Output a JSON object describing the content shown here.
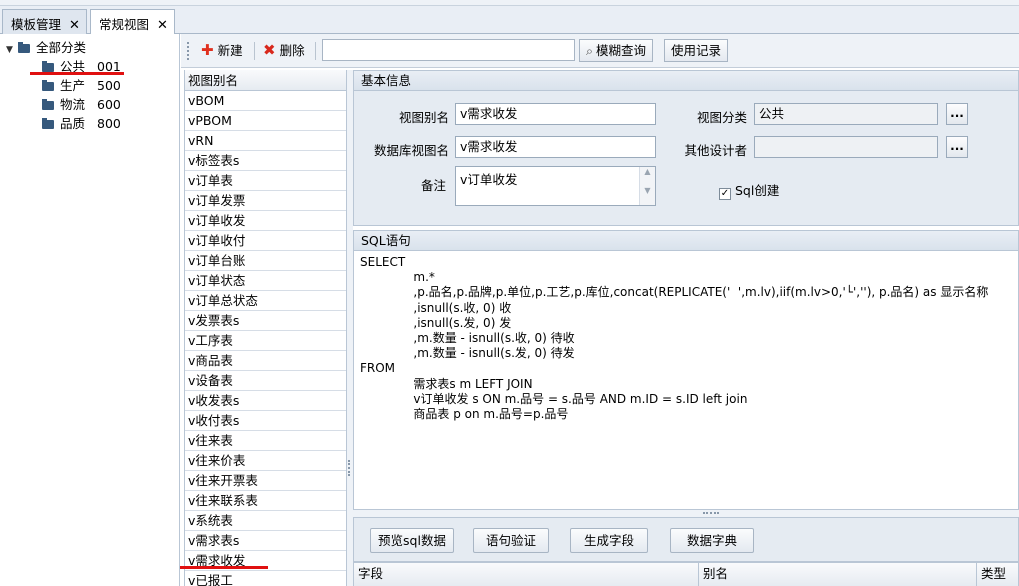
{
  "tabs": [
    {
      "label": "模板管理",
      "active": false
    },
    {
      "label": "常规视图",
      "active": true
    }
  ],
  "tab_close_glyph": "✕",
  "tree": {
    "root_label": "全部分类",
    "items": [
      {
        "name": "公共",
        "code": "001"
      },
      {
        "name": "生产",
        "code": "500"
      },
      {
        "name": "物流",
        "code": "600"
      },
      {
        "name": "品质",
        "code": "800"
      }
    ]
  },
  "toolbar": {
    "new_label": "新建",
    "delete_label": "删除",
    "search_value": "",
    "fuzzy_search_label": "模糊查询",
    "usage_log_label": "使用记录"
  },
  "view_list": {
    "header": "视图别名",
    "items": [
      "vBOM",
      "vPBOM",
      "vRN",
      "v标签表s",
      "v订单表",
      "v订单发票",
      "v订单收发",
      "v订单收付",
      "v订单台账",
      "v订单状态",
      "v订单总状态",
      "v发票表s",
      "v工序表",
      "v商品表",
      "v设备表",
      "v收发表s",
      "v收付表s",
      "v往来表",
      "v往来价表",
      "v往来开票表",
      "v往来联系表",
      "v系统表",
      "v需求表s",
      "v需求收发",
      "v已报工"
    ],
    "selected_index": 23
  },
  "basic_info": {
    "title": "基本信息",
    "alias_label": "视图别名",
    "alias_value": "v需求收发",
    "category_label": "视图分类",
    "category_value": "公共",
    "dbview_label": "数据库视图名",
    "dbview_value": "v需求收发",
    "designers_label": "其他设计者",
    "designers_value": "",
    "note_label": "备注",
    "note_value": "v订单收发",
    "sql_create_label": "Sql创建",
    "sql_create_checked": true,
    "browse_label": "..."
  },
  "sql": {
    "title": "SQL语句",
    "lines": [
      "SELECT",
      "              m.*",
      "              ,p.品名,p.品牌,p.单位,p.工艺,p.库位,concat(REPLICATE('  ',m.lv),iif(m.lv>0,'└',''), p.品名) as 显示名称",
      "              ,isnull(s.收, 0) 收",
      "              ,isnull(s.发, 0) 发",
      "              ,m.数量 - isnull(s.收, 0) 待收",
      "              ,m.数量 - isnull(s.发, 0) 待发",
      "FROM",
      "              需求表s m LEFT JOIN",
      "              v订单收发 s ON m.品号 = s.品号 AND m.ID = s.ID left join",
      "              商品表 p on m.品号=p.品号"
    ]
  },
  "actions": {
    "preview_label": "预览sql数据",
    "validate_label": "语句验证",
    "gen_fields_label": "生成字段",
    "dictionary_label": "数据字典"
  },
  "field_grid": {
    "columns": [
      "字段",
      "别名",
      "类型"
    ]
  },
  "colors": {
    "accent_red": "#e01010",
    "panel_bg": "#e5ebf2",
    "border": "#b9c6d5"
  }
}
